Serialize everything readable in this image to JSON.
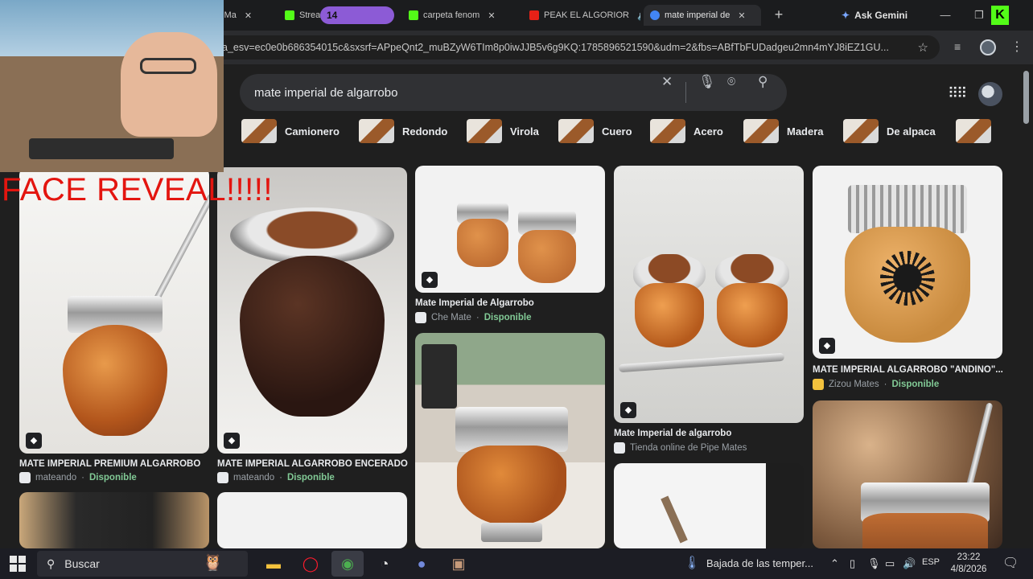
{
  "browser": {
    "tabs": [
      {
        "label": "k Ma",
        "favicon_color": "#53fc18"
      },
      {
        "label": "Strea",
        "favicon_color": "#53fc18"
      },
      {
        "label": "carpeta fenom",
        "favicon_color": "#53fc18"
      },
      {
        "label": "PEAK EL ALGORIOR",
        "favicon_color": "#e62117"
      },
      {
        "label": "mate imperial de",
        "favicon_color": "#4285f4",
        "active": true
      }
    ],
    "tab_group_label": "14",
    "ask_gemini_label": "Ask Gemini",
    "url": "a_esv=ec0e0b686354015c&sxsrf=APpeQnt2_muBZyW6TIm8p0iwJJB5v6g9KQ:1785896521590&udm=2&fbs=ABfTbFUDadgeu2mn4mYJ8iEZ1GU..."
  },
  "search": {
    "query": "mate imperial de algarrobo",
    "chips": [
      "Camionero",
      "Redondo",
      "Virola",
      "Cuero",
      "Acero",
      "Madera",
      "De alpaca"
    ]
  },
  "results": [
    {
      "title": "MATE IMPERIAL PREMIUM ALGARROBO",
      "source": "mateando",
      "status": "Disponible"
    },
    {
      "title": "MATE IMPERIAL ALGARROBO ENCERADO",
      "source": "mateando",
      "status": "Disponible"
    },
    {
      "title": "Mate Imperial de Algarrobo",
      "source": "Che Mate",
      "status": "Disponible"
    },
    {
      "title": "Mate Imperial de algarrobo",
      "source": "Tienda online de Pipe Mates",
      "status": ""
    },
    {
      "title": "MATE IMPERIAL ALGARROBO \"ANDINO\"...",
      "source": "Zizou Mates",
      "status": "Disponible"
    }
  ],
  "overlay": {
    "text": "FACE REVEAL!!!!!",
    "text_color": "#e3150f"
  },
  "taskbar": {
    "search_label": "Buscar",
    "weather": "Bajada de las temper...",
    "language": "ESP",
    "time": "23:22",
    "date": "4/8/2026"
  },
  "colors": {
    "available": "#81c995",
    "kick_green": "#53fc18",
    "tab_group": "#8c5bd6"
  }
}
